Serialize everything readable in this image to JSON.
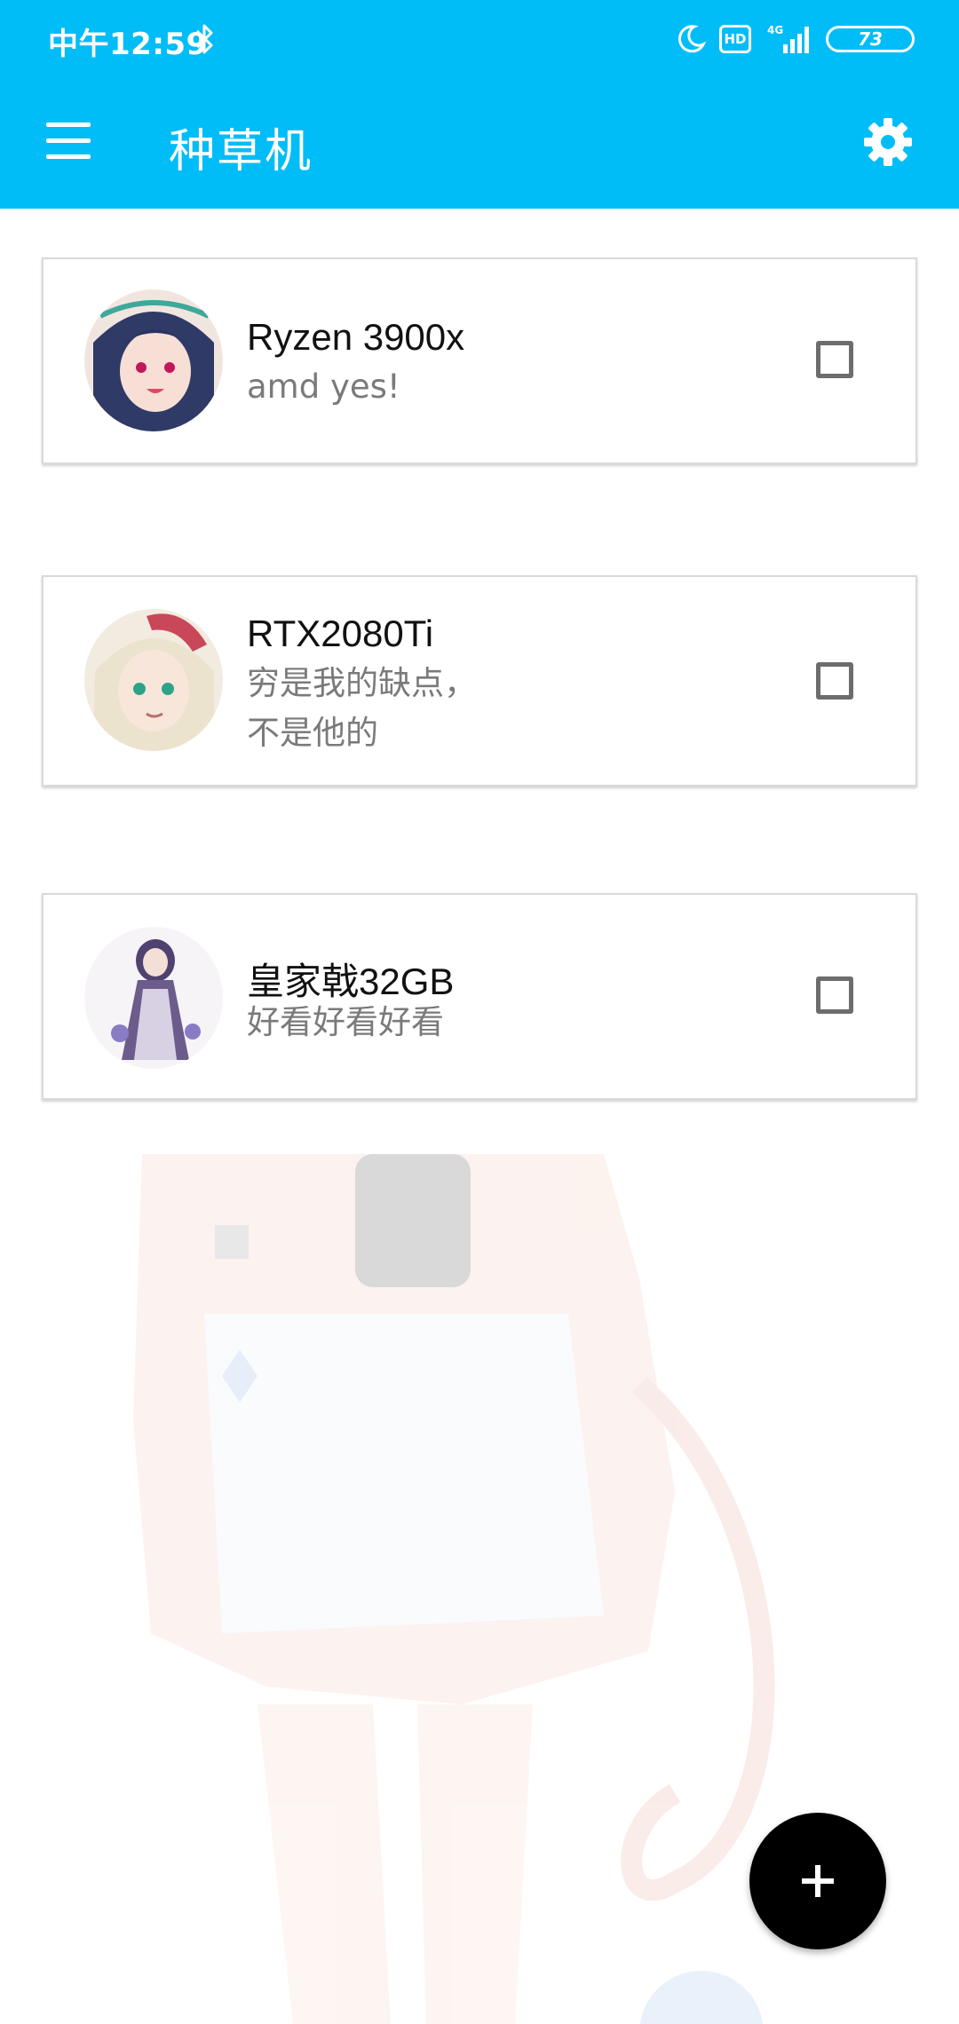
{
  "status_bar": {
    "time": "中午12:59",
    "hd": "HD",
    "network": "4G",
    "battery": "73"
  },
  "app_bar": {
    "title": "种草机",
    "menu_icon": "hamburger-menu-icon",
    "settings_icon": "gear-icon"
  },
  "items": [
    {
      "title": "Ryzen 3900x",
      "subtitle": "amd yes!",
      "checked": false
    },
    {
      "title": "RTX2080Ti",
      "subtitle": "穷是我的缺点，不是他的",
      "checked": false
    },
    {
      "title": "皇家戟32GB",
      "subtitle": "好看好看好看",
      "checked": false
    }
  ],
  "fab": {
    "icon": "plus-icon"
  },
  "colors": {
    "app_bar": "#00bdf8",
    "fab": "#000000",
    "checkbox": "#6d6d6d",
    "subtitle": "#7a7a7a"
  }
}
